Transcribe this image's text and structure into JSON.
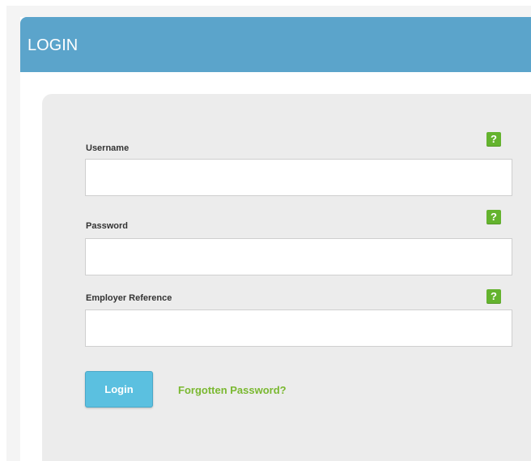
{
  "header": {
    "title": "LOGIN"
  },
  "form": {
    "username": {
      "label": "Username",
      "value": "",
      "help": "?"
    },
    "password": {
      "label": "Password",
      "value": "",
      "help": "?"
    },
    "employer_reference": {
      "label": "Employer Reference",
      "value": "",
      "help": "?"
    }
  },
  "actions": {
    "login_label": "Login",
    "forgot_label": "Forgotten Password?"
  },
  "colors": {
    "header": "#5ba4cb",
    "login_button": "#5bc0e0",
    "help_badge": "#64b32e",
    "link": "#7ab830"
  }
}
